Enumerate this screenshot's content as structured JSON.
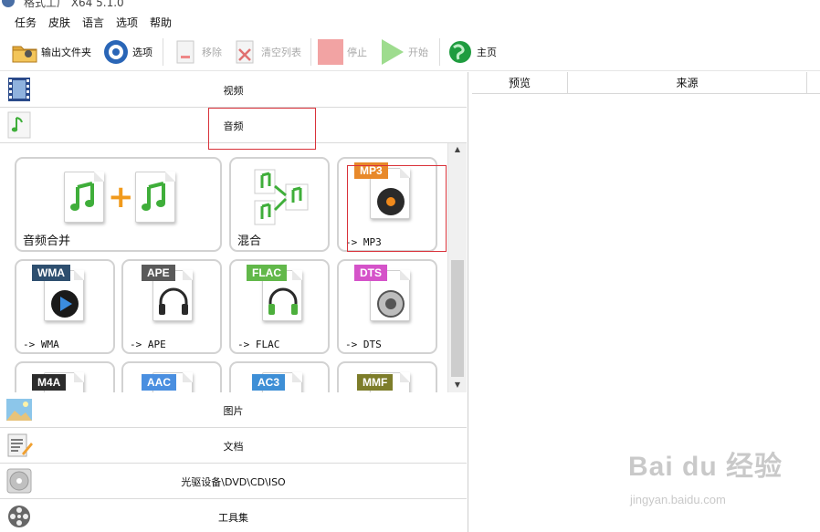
{
  "window": {
    "title": "格式工厂 X64 5.1.0"
  },
  "menu": [
    "任务",
    "皮肤",
    "语言",
    "选项",
    "帮助"
  ],
  "toolbar": {
    "output_folder": "输出文件夹",
    "options": "选项",
    "remove": "移除",
    "clear_list": "清空列表",
    "stop": "停止",
    "start": "开始",
    "home": "主页"
  },
  "categories": {
    "video": "视频",
    "audio": "音频",
    "image": "图片",
    "document": "文档",
    "disc": "光驱设备\\DVD\\CD\\ISO",
    "tools": "工具集"
  },
  "tiles": {
    "audio_join": "音频合并",
    "mix": "混合",
    "mp3": {
      "tag": "MP3",
      "label": "-> MP3",
      "color": "#e8892a"
    },
    "wma": {
      "tag": "WMA",
      "label": "-> WMA",
      "color": "#2e4f6f"
    },
    "ape": {
      "tag": "APE",
      "label": "-> APE",
      "color": "#5a5a5a"
    },
    "flac": {
      "tag": "FLAC",
      "label": "-> FLAC",
      "color": "#62b84a"
    },
    "dts": {
      "tag": "DTS",
      "label": "-> DTS",
      "color": "#d553c9"
    },
    "m4a": {
      "tag": "M4A",
      "color": "#2c2c2c"
    },
    "aac": {
      "tag": "AAC",
      "color": "#4a8fe0"
    },
    "ac3": {
      "tag": "AC3",
      "color": "#3e8fd6"
    },
    "mmf": {
      "tag": "MMF",
      "color": "#7d7d2a"
    }
  },
  "table": {
    "col_preview": "预览",
    "col_source": "来源"
  },
  "watermark": {
    "main": "Bai du 经验",
    "sub": "jingyan.baidu.com"
  },
  "colors": {
    "highlight": "#d9323a",
    "music_green": "#3fae3a"
  }
}
